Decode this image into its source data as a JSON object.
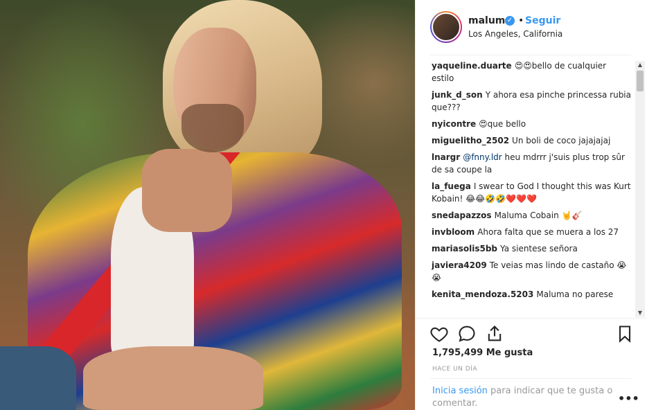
{
  "post": {
    "username": "maluma",
    "verified_icon": "verified-badge-icon",
    "separator": "•",
    "follow_label": "Seguir",
    "location": "Los Angeles, California"
  },
  "comments": [
    {
      "user": "yaqueline.duarte",
      "text": "😍😍bello de cualquier estilo"
    },
    {
      "user": "junk_d_son",
      "text": "Y ahora esa pinche princessa rubia que???"
    },
    {
      "user": "nyicontre",
      "text": "😍que bello"
    },
    {
      "user": "miguelitho_2502",
      "text": "Un boli de coco jajajajaj"
    },
    {
      "user": "lnargr",
      "mention": "@fnny.ldr",
      "text": "heu mdrrr j'suis plus trop sûr de sa coupe la"
    },
    {
      "user": "la_fuega",
      "text": "I swear to God I thought this was Kurt Kobain! 😂😂🤣🤣❤️❤️❤️"
    },
    {
      "user": "snedapazzos",
      "text": "Maluma Cobain 🤘🎸"
    },
    {
      "user": "invbloom",
      "text": "Ahora falta que se muera a los 27"
    },
    {
      "user": "mariasolis5bb",
      "text": "Ya sientese señora"
    },
    {
      "user": "javiera4209",
      "text": "Te veias mas lindo de castaño 😭😭"
    },
    {
      "user": "kenita_mendoza.5203",
      "text": "Maluma no parese"
    }
  ],
  "actions": {
    "icons": [
      "heart-icon",
      "comment-icon",
      "share-icon",
      "bookmark-icon"
    ]
  },
  "likes": "1,795,499 Me gusta",
  "time_ago": "HACE UN DÍA",
  "login_prompt": {
    "link": "Inicia sesión",
    "text": "para indicar que te gusta o comentar."
  },
  "more_icon": "more-options-icon"
}
